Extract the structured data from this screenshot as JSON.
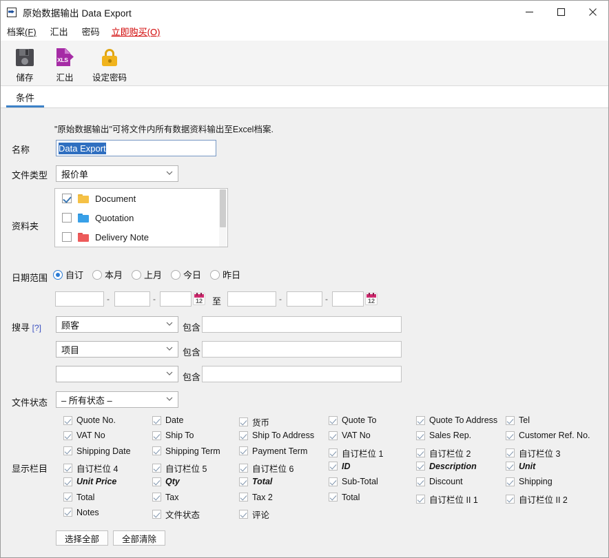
{
  "window": {
    "title": "原始数据输出 Data Export",
    "icon": "export-arrow-icon",
    "minimize": "—",
    "maximize": "□",
    "close": "✕"
  },
  "menubar": {
    "items": [
      {
        "label": "档案",
        "accel": "(F)",
        "accent": false
      },
      {
        "label": "汇出",
        "accel": "",
        "accent": false
      },
      {
        "label": "密码",
        "accel": "",
        "accent": false
      },
      {
        "label": "立即购买",
        "accel": "(O)",
        "accent": true
      }
    ]
  },
  "toolbar": {
    "buttons": [
      {
        "label": "储存",
        "icon": "floppy-save-icon"
      },
      {
        "label": "汇出",
        "icon": "xls-export-icon"
      },
      {
        "label": "设定密码",
        "icon": "padlock-icon"
      }
    ]
  },
  "tabs": [
    {
      "label": "条件",
      "active": true
    }
  ],
  "form": {
    "description": "\"原始数据输出\"可将文件内所有数据资料输出至Excel档案.",
    "name_label": "名称",
    "name_value": "Data Export",
    "filetype_label": "文件类型",
    "filetype_value": "报价单",
    "folders_label": "资料夹",
    "folders": [
      {
        "name": "Document",
        "checked": true,
        "color": "#f5c146"
      },
      {
        "name": "Quotation",
        "checked": false,
        "color": "#38a0e8"
      },
      {
        "name": "Delivery Note",
        "checked": false,
        "color": "#ed5b5b"
      },
      {
        "name": "",
        "checked": false,
        "color": "#f5c146"
      }
    ],
    "daterange_label": "日期范围",
    "daterange_options": [
      {
        "label": "自订",
        "selected": true
      },
      {
        "label": "本月",
        "selected": false
      },
      {
        "label": "上月",
        "selected": false
      },
      {
        "label": "今日",
        "selected": false
      },
      {
        "label": "昨日",
        "selected": false
      }
    ],
    "date_separator": "-",
    "date_to": "至",
    "calendar_icon_num": "12",
    "date_from": {
      "y": "",
      "m": "",
      "d": ""
    },
    "date_until": {
      "y": "",
      "m": "",
      "d": ""
    },
    "search_label": "搜寻",
    "search_help": "[?]",
    "contains_label": "包含",
    "search_rows": [
      {
        "field": "顾客",
        "value": ""
      },
      {
        "field": "项目",
        "value": ""
      },
      {
        "field": "",
        "value": ""
      }
    ],
    "status_label": "文件状态",
    "status_value": "– 所有状态 –",
    "columns_label": "显示栏目",
    "select_all": "选择全部",
    "clear_all": "全部清除"
  },
  "display_columns": [
    [
      {
        "label": "Quote No.",
        "checked": true,
        "emphasis": false
      },
      {
        "label": "VAT No",
        "checked": true,
        "emphasis": false
      },
      {
        "label": "Shipping Date",
        "checked": true,
        "emphasis": false
      },
      {
        "label": "自订栏位 4",
        "checked": true,
        "emphasis": false
      },
      {
        "label": "Unit Price",
        "checked": true,
        "emphasis": true
      },
      {
        "label": "Total",
        "checked": true,
        "emphasis": false
      },
      {
        "label": "Notes",
        "checked": true,
        "emphasis": false
      }
    ],
    [
      {
        "label": "Date",
        "checked": true,
        "emphasis": false
      },
      {
        "label": "Ship To",
        "checked": true,
        "emphasis": false
      },
      {
        "label": "Shipping Term",
        "checked": true,
        "emphasis": false
      },
      {
        "label": "自订栏位 5",
        "checked": true,
        "emphasis": false
      },
      {
        "label": "Qty",
        "checked": true,
        "emphasis": true
      },
      {
        "label": "Tax",
        "checked": true,
        "emphasis": false
      },
      {
        "label": "文件状态",
        "checked": true,
        "emphasis": false
      }
    ],
    [
      {
        "label": "货币",
        "checked": true,
        "emphasis": false
      },
      {
        "label": "Ship To Address",
        "checked": true,
        "emphasis": false
      },
      {
        "label": "Payment Term",
        "checked": true,
        "emphasis": false
      },
      {
        "label": "自订栏位 6",
        "checked": true,
        "emphasis": false
      },
      {
        "label": "Total",
        "checked": true,
        "emphasis": true
      },
      {
        "label": "Tax 2",
        "checked": true,
        "emphasis": false
      },
      {
        "label": "评论",
        "checked": true,
        "emphasis": false
      }
    ],
    [
      {
        "label": "Quote To",
        "checked": true,
        "emphasis": false
      },
      {
        "label": "VAT No",
        "checked": true,
        "emphasis": false
      },
      {
        "label": "自订栏位 1",
        "checked": true,
        "emphasis": false
      },
      {
        "label": "ID",
        "checked": true,
        "emphasis": true
      },
      {
        "label": "Sub-Total",
        "checked": true,
        "emphasis": false
      },
      {
        "label": "Total",
        "checked": true,
        "emphasis": false
      }
    ],
    [
      {
        "label": "Quote To Address",
        "checked": true,
        "emphasis": false
      },
      {
        "label": "Sales Rep.",
        "checked": true,
        "emphasis": false
      },
      {
        "label": "自订栏位 2",
        "checked": true,
        "emphasis": false
      },
      {
        "label": "Description",
        "checked": true,
        "emphasis": true
      },
      {
        "label": "Discount",
        "checked": true,
        "emphasis": false
      },
      {
        "label": "自订栏位 II 1",
        "checked": true,
        "emphasis": false
      }
    ],
    [
      {
        "label": "Tel",
        "checked": true,
        "emphasis": false
      },
      {
        "label": "Customer Ref. No.",
        "checked": true,
        "emphasis": false
      },
      {
        "label": "自订栏位 3",
        "checked": true,
        "emphasis": false
      },
      {
        "label": "Unit",
        "checked": true,
        "emphasis": true
      },
      {
        "label": "Shipping",
        "checked": true,
        "emphasis": false
      },
      {
        "label": "自订栏位 II 2",
        "checked": true,
        "emphasis": false
      }
    ]
  ],
  "colors": {
    "accent": "#3c81c7",
    "buy_link": "#d00000",
    "selection": "#2f6fc0",
    "calendar": "#cf2a6e"
  }
}
